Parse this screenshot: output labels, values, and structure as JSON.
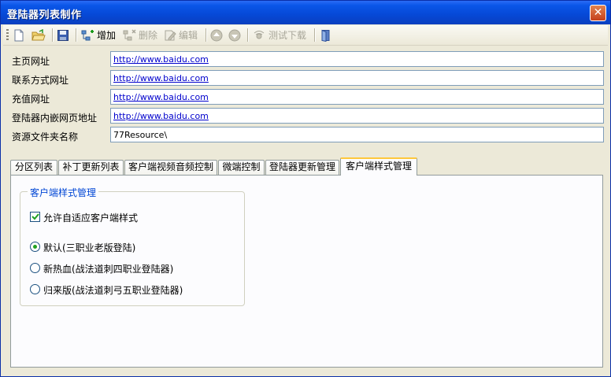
{
  "window": {
    "title": "登陆器列表制作"
  },
  "toolbar": {
    "add_label": "增加",
    "delete_label": "删除",
    "edit_label": "编辑",
    "test_download_label": "测试下载"
  },
  "fields": [
    {
      "label": "主页网址",
      "value": "http://www.baidu.com"
    },
    {
      "label": "联系方式网址",
      "value": "http://www.baidu.com"
    },
    {
      "label": "充值网址",
      "value": "http://www.baidu.com"
    },
    {
      "label": "登陆器内嵌网页地址",
      "value": "http://www.baidu.com"
    },
    {
      "label": "资源文件夹名称",
      "value": "77Resource\\"
    }
  ],
  "tabs": [
    "分区列表",
    "补丁更新列表",
    "客户端视频音频控制",
    "微端控制",
    "登陆器更新管理",
    "客户端样式管理"
  ],
  "active_tab": "客户端样式管理",
  "style_group": {
    "title": "客户端样式管理",
    "checkbox_label": "允许自适应客户端样式",
    "checkbox_checked": true,
    "options": [
      {
        "label": "默认(三职业老版登陆)",
        "selected": true
      },
      {
        "label": "新热血(战法道刺四职业登陆器)",
        "selected": false
      },
      {
        "label": "归来版(战法道刺弓五职业登陆器)",
        "selected": false
      }
    ]
  }
}
